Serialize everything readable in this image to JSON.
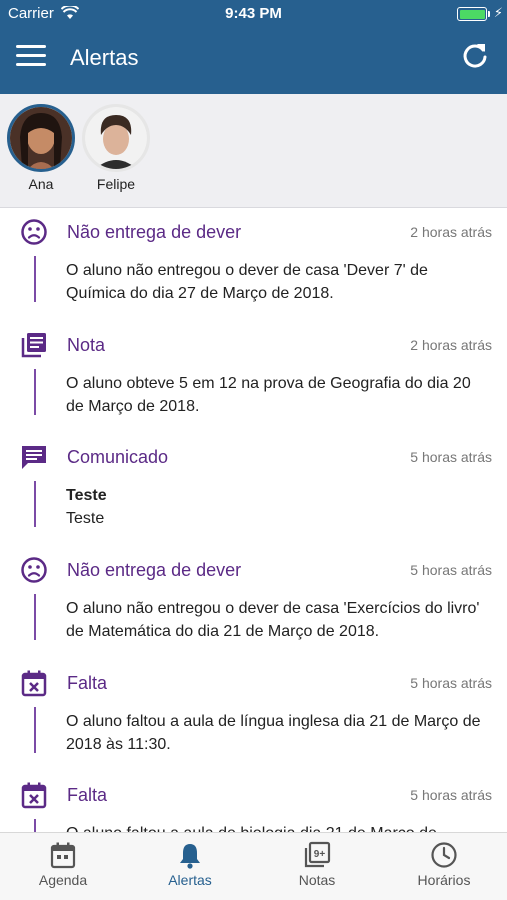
{
  "status_bar": {
    "carrier": "Carrier",
    "time": "9:43 PM"
  },
  "header": {
    "title": "Alertas"
  },
  "children": [
    {
      "name": "Ana",
      "selected": true
    },
    {
      "name": "Felipe",
      "selected": false
    }
  ],
  "alerts": [
    {
      "icon": "sad-face-icon",
      "title": "Não entrega de dever",
      "time": "2 horas atrás",
      "body": "O aluno não entregou o dever de casa 'Dever 7' de Química do dia 27 de Março de 2018."
    },
    {
      "icon": "notes-icon",
      "title": "Nota",
      "time": "2 horas atrás",
      "body": "O aluno obteve 5 em 12 na prova de Geografia do dia 20 de Março de 2018."
    },
    {
      "icon": "message-icon",
      "title": "Comunicado",
      "time": "5 horas atrás",
      "body_bold": "Teste",
      "body": "Teste"
    },
    {
      "icon": "sad-face-icon",
      "title": "Não entrega de dever",
      "time": "5 horas atrás",
      "body": "O aluno não entregou o dever de casa 'Exercícios do livro' de Matemática do dia 21 de Março de 2018."
    },
    {
      "icon": "calendar-x-icon",
      "title": "Falta",
      "time": "5 horas atrás",
      "body": "O aluno faltou a aula de língua inglesa dia 21 de Março de 2018 às 11:30."
    },
    {
      "icon": "calendar-x-icon",
      "title": "Falta",
      "time": "5 horas atrás",
      "body": "O aluno faltou a aula de biologia dia 21 de Março de"
    }
  ],
  "tabs": [
    {
      "label": "Agenda",
      "icon": "calendar-icon",
      "active": false
    },
    {
      "label": "Alertas",
      "icon": "bell-icon",
      "active": true
    },
    {
      "label": "Notas",
      "icon": "grades-icon",
      "active": false
    },
    {
      "label": "Horários",
      "icon": "clock-icon",
      "active": false
    }
  ],
  "colors": {
    "header": "#27608f",
    "accent": "#5b2a86",
    "active_tab": "#27608f",
    "battery": "#4cd964"
  }
}
